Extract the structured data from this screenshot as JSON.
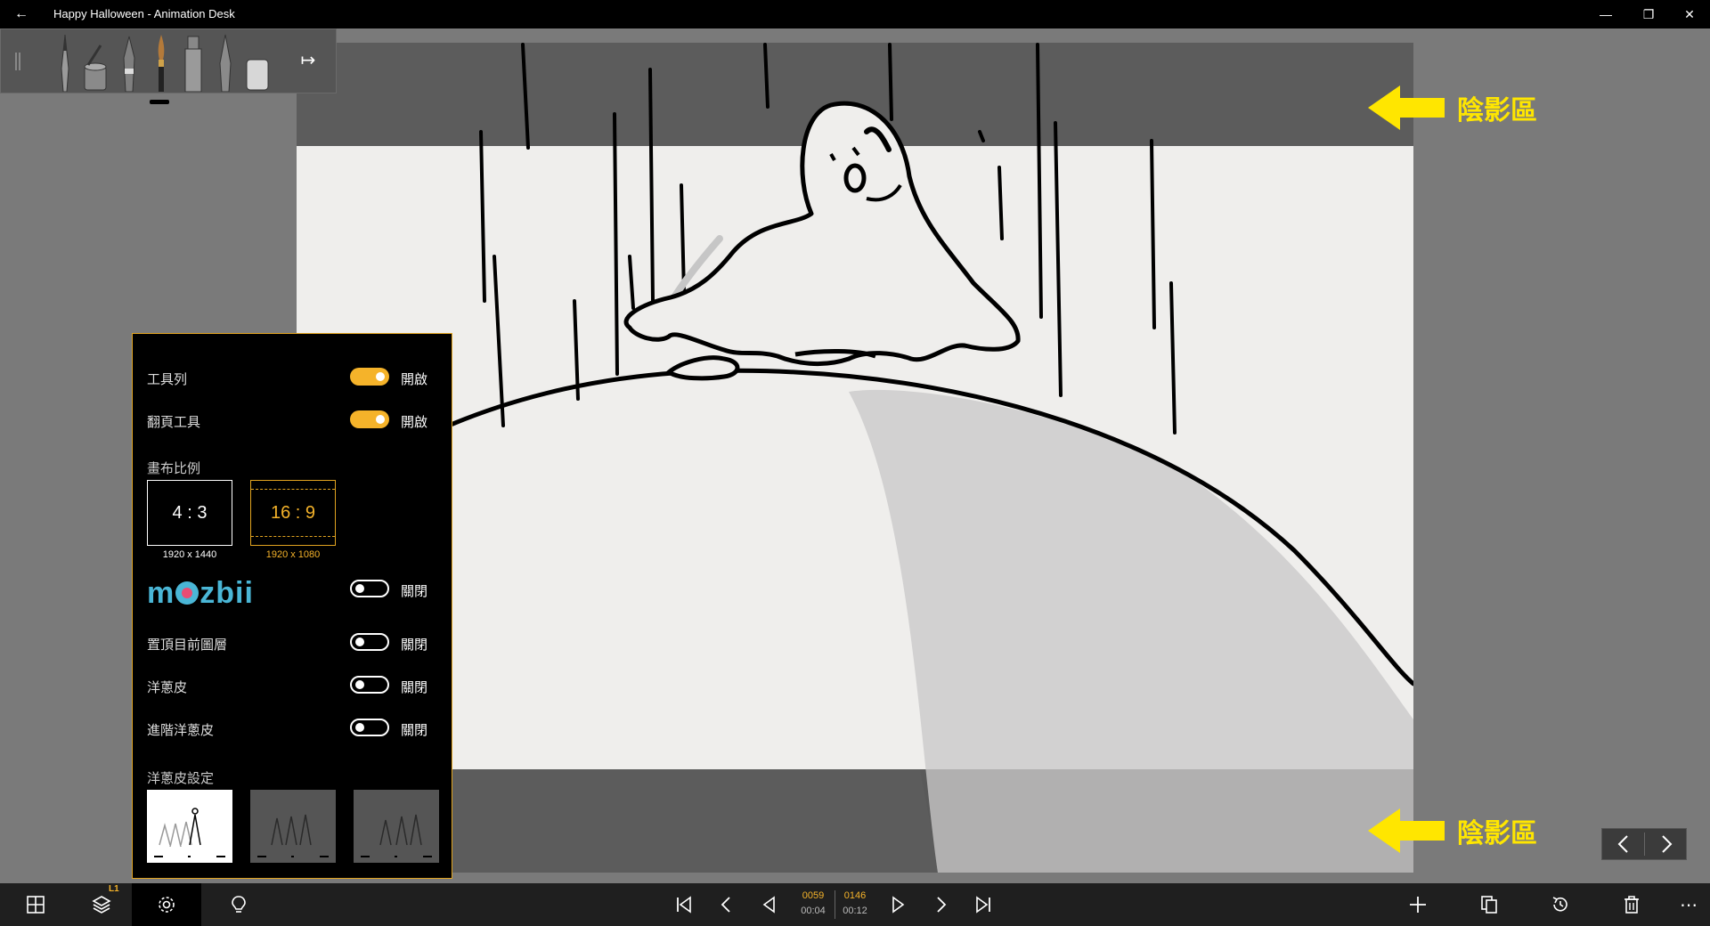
{
  "window": {
    "title": "Happy Halloween - Animation Desk",
    "back_glyph": "←",
    "minimize_glyph": "—",
    "restore_glyph": "❐",
    "close_glyph": "✕"
  },
  "toolstrip": {
    "tools": [
      "pencil-icon",
      "paint-bucket-icon",
      "fountain-pen-icon",
      "brush-icon",
      "marker-icon",
      "pen-icon",
      "eraser-icon"
    ],
    "active_tool": "brush-icon",
    "collapse_glyph": "↦"
  },
  "annotations": {
    "top_label": "陰影區",
    "bottom_label": "陰影區",
    "arrow_color": "#ffe600"
  },
  "settings": {
    "toolbar_label": "工具列",
    "toolbar_state": "開啟",
    "pageflip_label": "翻頁工具",
    "pageflip_state": "開啟",
    "canvas_ratio_label": "畫布比例",
    "ratio_43": "4 : 3",
    "ratio_43_dim": "1920 x 1440",
    "ratio_169": "16 : 9",
    "ratio_169_dim": "1920 x 1080",
    "mozbii_brand": "mozbii",
    "mozbii_state": "關閉",
    "pin_layer_label": "置頂目前圖層",
    "pin_layer_state": "關閉",
    "onion_label": "洋蔥皮",
    "onion_state": "關閉",
    "adv_onion_label": "進階洋蔥皮",
    "adv_onion_state": "關閉",
    "onion_settings_label": "洋蔥皮設定",
    "accent": "#f5b32a"
  },
  "bottombar": {
    "layer_badge": "L1",
    "current_frame": "0059",
    "current_time": "00:04",
    "total_frames": "0146",
    "total_time": "00:12",
    "more_glyph": "⋯"
  },
  "pagenav": {
    "prev_glyph": "‹",
    "next_glyph": "›"
  }
}
